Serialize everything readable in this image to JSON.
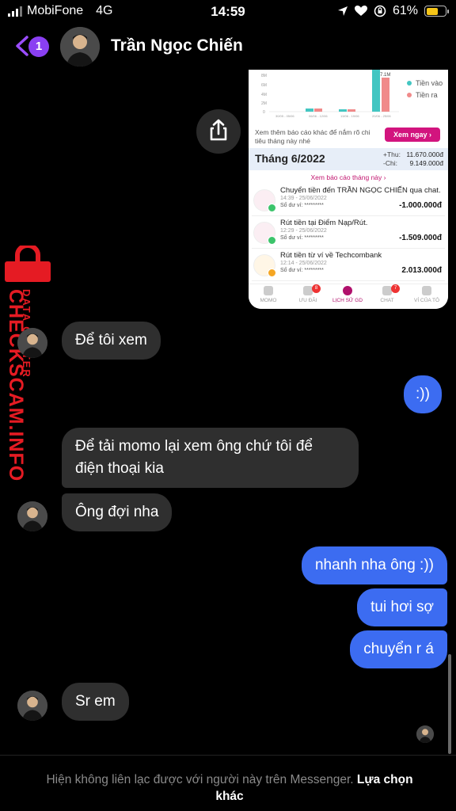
{
  "status_bar": {
    "carrier": "MobiFone",
    "network": "4G",
    "time": "14:59",
    "battery": "61%"
  },
  "header": {
    "back_badge_count": "1",
    "contact_name": "Trần Ngọc Chiến"
  },
  "shared_image": {
    "chart_axis_labels": [
      "8M",
      "6M",
      "4M",
      "2M",
      "0"
    ],
    "chart_top_value": "7.1M",
    "chart_dates": [
      "30/05 - 05/06",
      "06/06 - 12/06",
      "13/06 - 19/06",
      "20/06 - 25/06"
    ],
    "legend_in": "Tiền vào",
    "legend_out": "Tiền ra",
    "legend_colors": {
      "in": "#43c6c2",
      "out": "#f08a8a"
    },
    "promo_text": "Xem thêm báo cáo khác để nắm rõ chi tiêu tháng này nhé",
    "promo_button": "Xem ngay",
    "month_title": "Tháng 6/2022",
    "income_label": "+Thu:",
    "income_value": "11.670.000đ",
    "expense_label": "-Chi:",
    "expense_value": "9.149.000đ",
    "report_link": "Xem báo cáo tháng này",
    "transactions": [
      {
        "title": "Chuyển tiền đến TRẦN NGỌC CHIẾN qua chat.",
        "time": "14:39 - 25/06/2022",
        "balance": "Số dư ví: *********",
        "amount": "-1.000.000đ"
      },
      {
        "title": "Rút tiền tại Điểm Nạp/Rút.",
        "time": "12:29 - 25/06/2022",
        "balance": "Số dư ví: *********",
        "amount": "-1.509.000đ"
      },
      {
        "title": "Rút tiền từ ví về Techcombank",
        "time": "12:14 - 25/06/2022",
        "balance": "Số dư ví: *********",
        "amount": "2.013.000đ"
      }
    ],
    "nav": [
      {
        "label": "MOMO",
        "badge": ""
      },
      {
        "label": "ƯU ĐÃI",
        "badge": "8"
      },
      {
        "label": "LỊCH SỬ GD",
        "badge": ""
      },
      {
        "label": "CHAT",
        "badge": "7"
      },
      {
        "label": "VÍ CỦA TÔ",
        "badge": ""
      }
    ]
  },
  "watermark": {
    "line1": "DATA CENTER",
    "line2": "CHECKSCAM.INFO"
  },
  "messages": [
    {
      "from": "them",
      "text": "Để tôi xem"
    },
    {
      "from": "me",
      "text": ":))"
    },
    {
      "from": "them",
      "text": "Để tải momo lại xem ông chứ tôi để điện thoại kia"
    },
    {
      "from": "them",
      "text": "Ông đợi nha"
    },
    {
      "from": "me",
      "text": "nhanh nha ông :))"
    },
    {
      "from": "me",
      "text": "tui hơi sợ"
    },
    {
      "from": "me",
      "text": "chuyển r á"
    },
    {
      "from": "them",
      "text": "Sr em"
    }
  ],
  "footer": {
    "notice": "Hiện không liên lạc được với người này trên Messenger.",
    "link": "Lựa chọn khác"
  }
}
